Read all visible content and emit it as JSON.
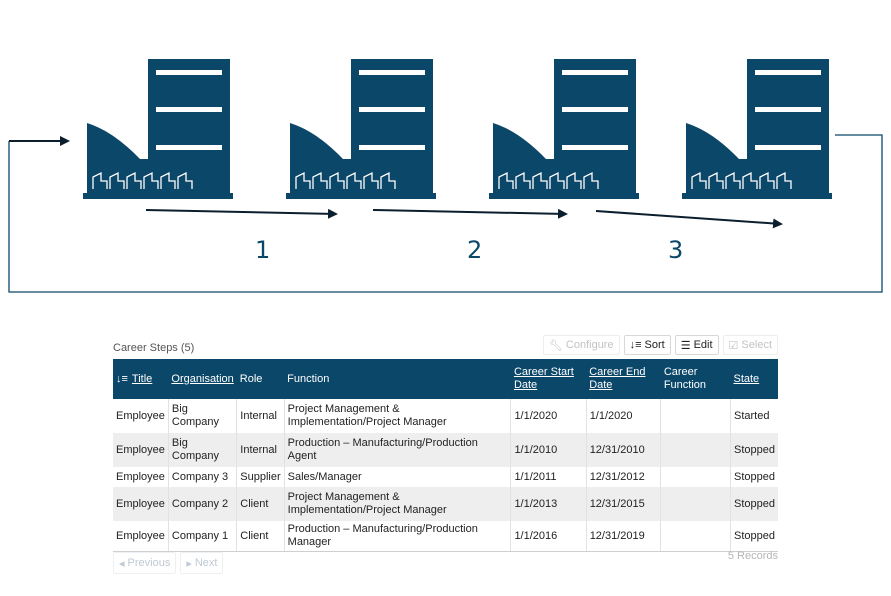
{
  "diagram": {
    "step_labels": [
      "1",
      "2",
      "3"
    ],
    "color": "#0b4769"
  },
  "grid": {
    "caption": "Career Steps (5)",
    "toolbar": {
      "configure": "Configure",
      "sort": "Sort",
      "edit": "Edit",
      "select": "Select"
    },
    "columns": [
      "Title",
      "Organisation",
      "Role",
      "Function",
      "Career Start Date",
      "Career End Date",
      "Career Function",
      "State"
    ],
    "rows": [
      [
        "Employee",
        "Big Company",
        "Internal",
        "Project Management & Implementation/Project Manager",
        "1/1/2020",
        "1/1/2020",
        "",
        "Started"
      ],
      [
        "Employee",
        "Big Company",
        "Internal",
        "Production – Manufacturing/Production Agent",
        "1/1/2010",
        "12/31/2010",
        "",
        "Stopped"
      ],
      [
        "Employee",
        "Company 3",
        "Supplier",
        "Sales/Manager",
        "1/1/2011",
        "12/31/2012",
        "",
        "Stopped"
      ],
      [
        "Employee",
        "Company 2",
        "Client",
        "Project Management & Implementation/Project Manager",
        "1/1/2013",
        "12/31/2015",
        "",
        "Stopped"
      ],
      [
        "Employee",
        "Company 1",
        "Client",
        "Production – Manufacturing/Production Manager",
        "1/1/2016",
        "12/31/2019",
        "",
        "Stopped"
      ]
    ],
    "pager": {
      "previous": "Previous",
      "next": "Next",
      "records": "5 Records"
    },
    "header_bg": "#0b4769"
  }
}
